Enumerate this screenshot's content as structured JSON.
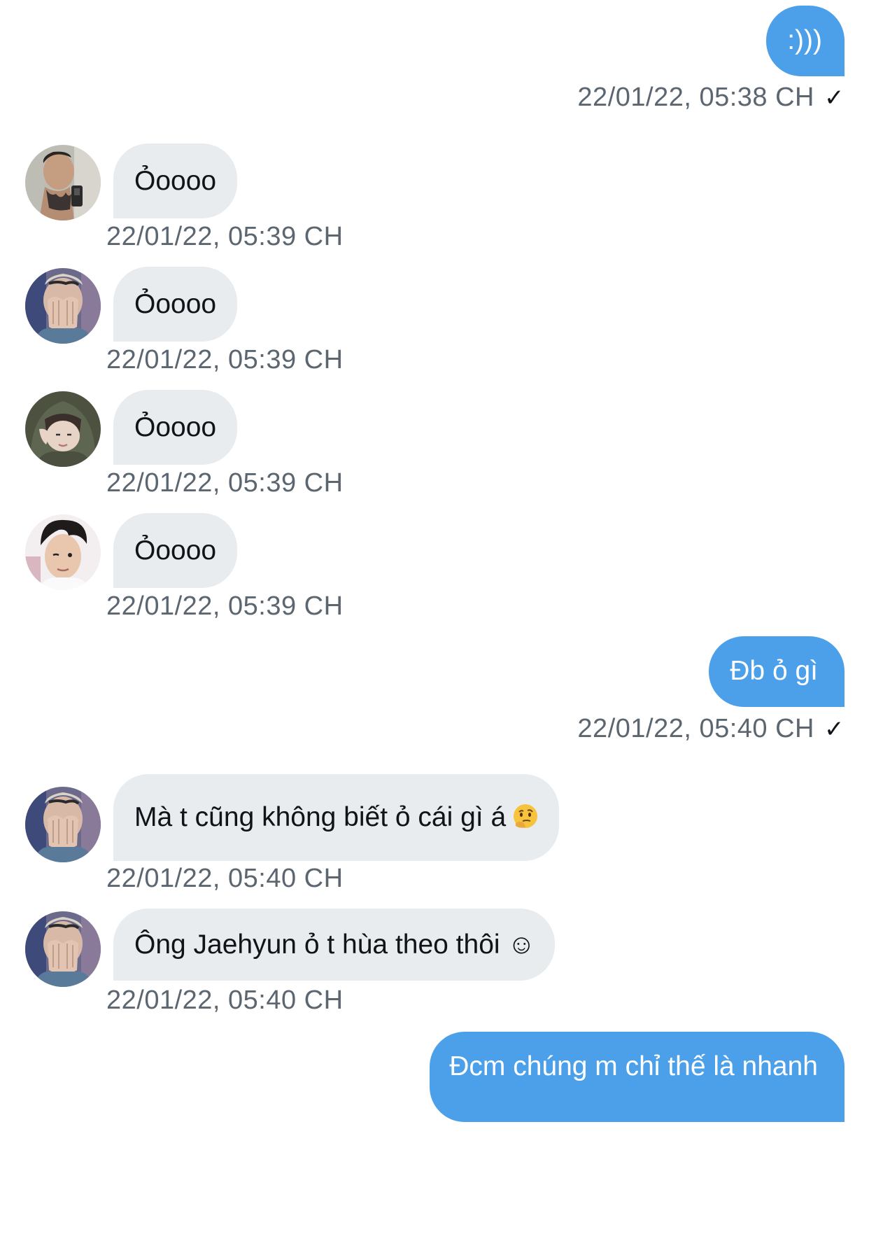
{
  "messages": [
    {
      "side": "out",
      "text": ":)))",
      "time": "22/01/22, 05:38 CH",
      "read_icon": "check-icon"
    },
    {
      "side": "in",
      "text": "Ỏoooo",
      "time": "22/01/22, 05:39 CH",
      "avatar": "avatar-tattoo"
    },
    {
      "side": "in",
      "text": "Ỏoooo",
      "time": "22/01/22, 05:39 CH",
      "avatar": "avatar-hands"
    },
    {
      "side": "in",
      "text": "Ỏoooo",
      "time": "22/01/22, 05:39 CH",
      "avatar": "avatar-hood"
    },
    {
      "side": "in",
      "text": "Ỏoooo",
      "time": "22/01/22, 05:39 CH",
      "avatar": "avatar-wink"
    },
    {
      "side": "out",
      "text": "Đb ỏ gì",
      "time": "22/01/22, 05:40 CH",
      "read_icon": "check-icon"
    },
    {
      "side": "in",
      "text": "Mà t cũng không biết ỏ cái gì á",
      "emoji": "thinking-face-emoji",
      "time": "22/01/22, 05:40 CH",
      "avatar": "avatar-hands"
    },
    {
      "side": "in",
      "text": "Ông Jaehyun ỏ t hùa theo thôi ☺",
      "time": "22/01/22, 05:40 CH",
      "avatar": "avatar-hands"
    },
    {
      "side": "out",
      "text": "Đcm chúng m chỉ thế là nhanh"
    }
  ],
  "colors": {
    "outgoing_bubble": "#4ca0ea",
    "incoming_bubble": "#e8ecef",
    "timestamp": "#5b6670"
  }
}
